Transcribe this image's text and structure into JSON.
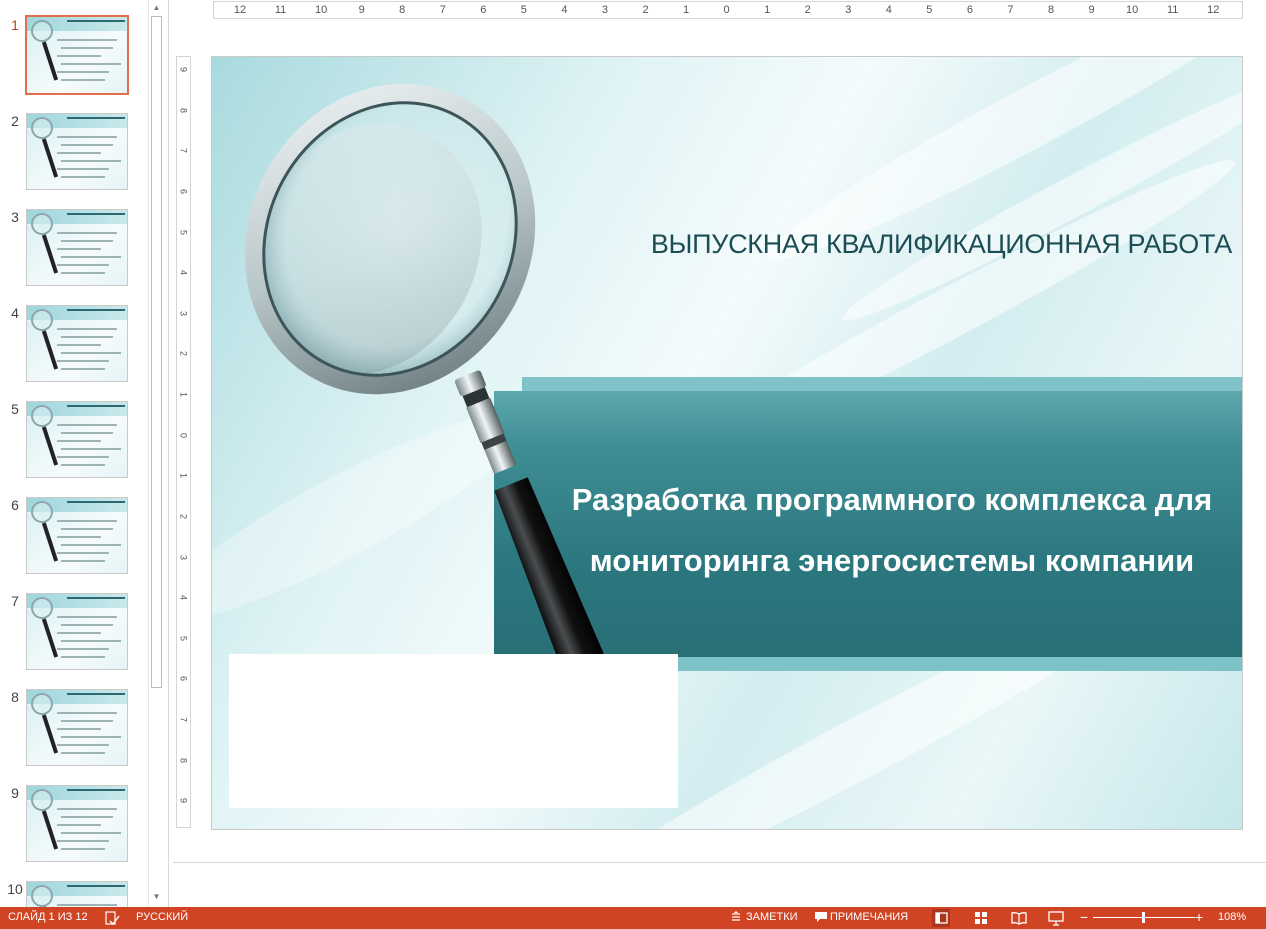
{
  "thumbnails": [
    {
      "number": "1",
      "active": true
    },
    {
      "number": "2",
      "active": false
    },
    {
      "number": "3",
      "active": false
    },
    {
      "number": "4",
      "active": false
    },
    {
      "number": "5",
      "active": false
    },
    {
      "number": "6",
      "active": false
    },
    {
      "number": "7",
      "active": false
    },
    {
      "number": "8",
      "active": false
    },
    {
      "number": "9",
      "active": false
    },
    {
      "number": "10",
      "active": false
    }
  ],
  "ruler": {
    "horizontal": [
      "12",
      "11",
      "10",
      "9",
      "8",
      "7",
      "6",
      "5",
      "4",
      "3",
      "2",
      "1",
      "0",
      "1",
      "2",
      "3",
      "4",
      "5",
      "6",
      "7",
      "8",
      "9",
      "10",
      "11",
      "12"
    ],
    "vertical": [
      "9",
      "8",
      "7",
      "6",
      "5",
      "4",
      "3",
      "2",
      "1",
      "0",
      "1",
      "2",
      "3",
      "4",
      "5",
      "6",
      "7",
      "8",
      "9"
    ]
  },
  "slide": {
    "title": "ВЫПУСКНАЯ КВАЛИФИКАЦИОННАЯ РАБОТА",
    "subtitle": "Разработка программного комплекса для мониторинга энергосистемы компании"
  },
  "statusbar": {
    "slide_info": "СЛАЙД 1 ИЗ 12",
    "language": "РУССКИЙ",
    "notes": "ЗАМЕТКИ",
    "comments": "ПРИМЕЧАНИЯ",
    "zoom": "108%",
    "zoom_minus": "−",
    "zoom_plus": "+"
  },
  "icons": {
    "spellcheck": "spellcheck-icon",
    "notes": "notes-icon",
    "comments": "comment-icon",
    "normal_view": "normal-view-icon",
    "slide_sorter": "slide-sorter-icon",
    "reading_view": "reading-view-icon",
    "slideshow": "slideshow-icon"
  },
  "colors": {
    "statusbar": "#d04424",
    "active_thumb_border": "#e36e4c",
    "title_text": "#1b4d54",
    "band": "#2c7880"
  }
}
